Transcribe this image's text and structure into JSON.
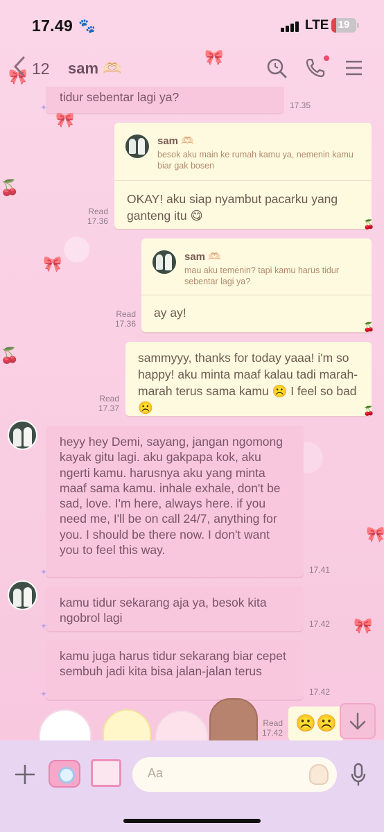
{
  "status": {
    "time": "17.49",
    "network": "LTE",
    "battery": "19",
    "battery_level": 0.19
  },
  "header": {
    "back_count": "12",
    "contact_name": "sam 🫶🏻"
  },
  "messages": [
    {
      "id": "m1",
      "text": "tidur sebentar lagi ya?",
      "time": "17.35"
    },
    {
      "id": "m2",
      "quoted_name": "sam 🫶🏻",
      "quoted_text": "besok aku main ke rumah kamu ya, nemenin kamu biar gak bosen",
      "text": "OKAY! aku siap nyambut pacarku yang ganteng itu 😋",
      "status": "Read",
      "time": "17.36"
    },
    {
      "id": "m3",
      "quoted_name": "sam 🫶🏻",
      "quoted_text": "mau aku temenin? tapi kamu harus tidur sebentar lagi ya?",
      "text": "ay ay!",
      "status": "Read",
      "time": "17.36"
    },
    {
      "id": "m4",
      "text": "sammyyy, thanks for today yaaa! i'm so happy! aku minta maaf kalau tadi marah-marah terus sama kamu ☹️ I feel so bad ☹️",
      "status": "Read",
      "time": "17.37"
    },
    {
      "id": "m5",
      "text": "heyy hey Demi, sayang, jangan ngomong kayak gitu lagi. aku gakpapa kok, aku ngerti kamu. harusnya aku yang minta maaf sama kamu. inhale exhale, don't be sad, love. I'm here, always here. if you need me, I'll be on call 24/7, anything for you. I should be there now. I don't want you to feel this way.",
      "time": "17.41"
    },
    {
      "id": "m6",
      "text": "kamu tidur sekarang aja ya, besok kita ngobrol lagi",
      "time": "17.42"
    },
    {
      "id": "m7",
      "text": "kamu juga harus tidur sekarang biar cepet sembuh jadi kita bisa jalan-jalan terus",
      "time": "17.42"
    },
    {
      "id": "m8",
      "text": "☹️☹️",
      "status": "Read",
      "time": "17.42"
    }
  ],
  "input": {
    "placeholder": "Aa"
  },
  "icons": {
    "back": "chevron-left-icon",
    "search": "search-icon",
    "call": "phone-icon",
    "menu": "menu-icon",
    "add": "plus-icon",
    "camera": "camera-icon",
    "gallery": "image-icon",
    "sticker": "sticker-icon",
    "mic": "microphone-icon",
    "scroll": "arrow-down-icon"
  },
  "colors": {
    "incoming_bubble": "#f8c7de",
    "outgoing_bubble": "#fdfae0",
    "background": "#fbd3e6",
    "input_bar": "#e8d5f2",
    "notification_dot": "#ee4a6a"
  }
}
